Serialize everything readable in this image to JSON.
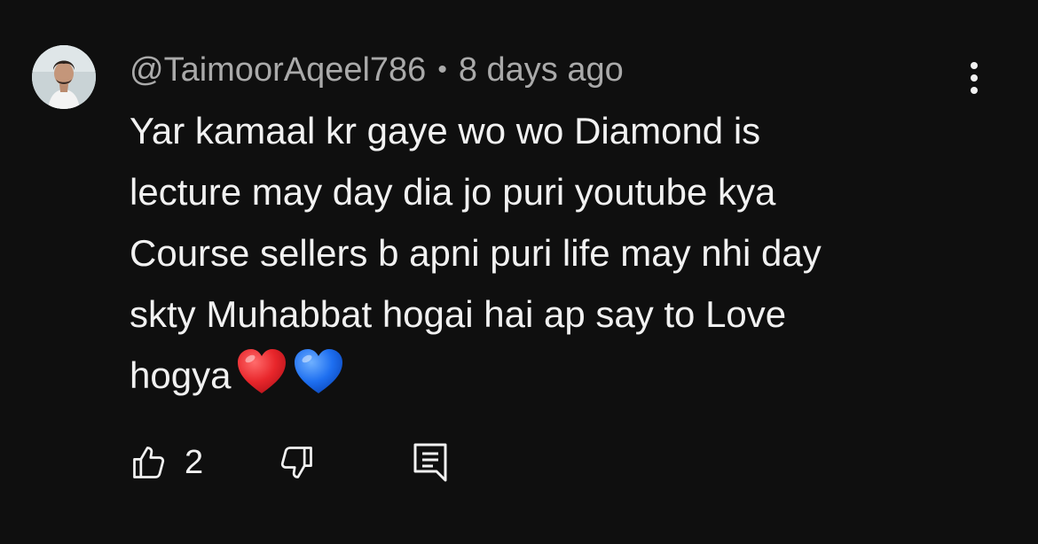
{
  "comment": {
    "author": "@TaimoorAqeel786",
    "separator": "•",
    "time": "8 days ago",
    "text": "Yar kamaal kr gaye wo wo Diamond is\nlecture may day dia jo puri youtube kya\nCourse sellers b apni puri life may nhi day\nskty Muhabbat hogai hai ap say to Love\nhogya",
    "emojis": [
      "red-heart",
      "blue-heart"
    ],
    "likes": "2"
  },
  "icons": {
    "menu": "more-vertical-icon",
    "like": "thumbs-up-icon",
    "dislike": "thumbs-down-icon",
    "reply": "reply-comment-icon"
  },
  "colors": {
    "background": "#0f0f0f",
    "primary_text": "#f1f1f1",
    "secondary_text": "#aaaaaa",
    "red_heart": "#e8262b",
    "blue_heart": "#1e6ff0"
  }
}
